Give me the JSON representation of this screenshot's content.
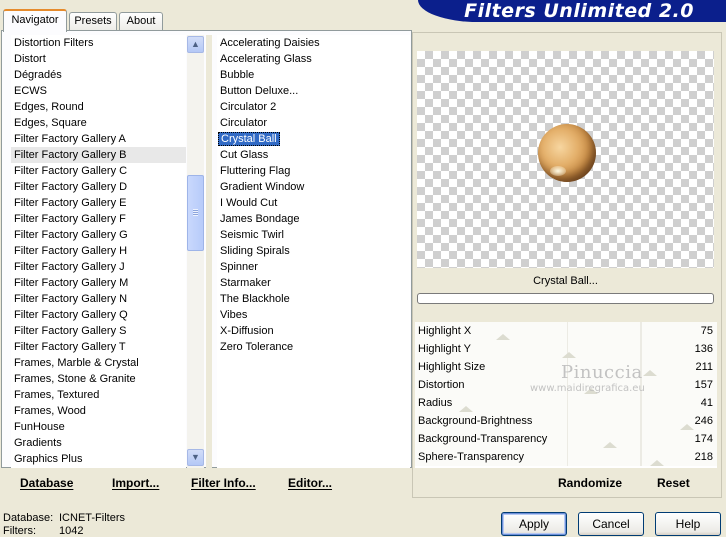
{
  "window": {
    "banner_title": "Filters Unlimited 2.0"
  },
  "tabs": [
    {
      "label": "Navigator",
      "active": true
    },
    {
      "label": "Presets",
      "active": false
    },
    {
      "label": "About",
      "active": false
    }
  ],
  "categories": {
    "items": [
      "Distortion Filters",
      "Distort",
      "Dégradés",
      "ECWS",
      "Edges, Round",
      "Edges, Square",
      "Filter Factory Gallery A",
      "Filter Factory Gallery B",
      "Filter Factory Gallery C",
      "Filter Factory Gallery D",
      "Filter Factory Gallery E",
      "Filter Factory Gallery F",
      "Filter Factory Gallery G",
      "Filter Factory Gallery H",
      "Filter Factory Gallery J",
      "Filter Factory Gallery M",
      "Filter Factory Gallery N",
      "Filter Factory Gallery Q",
      "Filter Factory Gallery S",
      "Filter Factory Gallery T",
      "Frames, Marble & Crystal",
      "Frames, Stone & Granite",
      "Frames, Textured",
      "Frames, Wood",
      "FunHouse",
      "Gradients",
      "Graphics Plus"
    ],
    "selected": "Filter Factory Gallery B",
    "scroll_position": 0.55
  },
  "filters": {
    "items": [
      "Accelerating Daisies",
      "Accelerating Glass",
      "Bubble",
      "Button Deluxe...",
      "Circulator 2",
      "Circulator",
      "Crystal Ball",
      "Cut Glass",
      "Fluttering Flag",
      "Gradient Window",
      "I Would Cut",
      "James Bondage",
      "Seismic Twirl",
      "Sliding Spirals",
      "Spinner",
      "Starmaker",
      "The Blackhole",
      "Vibes",
      "X-Diffusion",
      "Zero Tolerance"
    ],
    "selected": "Crystal Ball"
  },
  "left_buttons": {
    "database": "Database",
    "import": "Import...",
    "filter_info": "Filter Info...",
    "editor": "Editor..."
  },
  "preview": {
    "filter_name": "Crystal Ball...",
    "progress": 0
  },
  "params": [
    {
      "label": "Highlight X",
      "value": "75",
      "level": 75
    },
    {
      "label": "Highlight Y",
      "value": "136",
      "level": 136
    },
    {
      "label": "Highlight Size",
      "value": "211",
      "level": 211
    },
    {
      "label": "Distortion",
      "value": "157",
      "level": 157
    },
    {
      "label": "Radius",
      "value": "41",
      "level": 41
    },
    {
      "label": "Background-Brightness",
      "value": "246",
      "level": 246
    },
    {
      "label": "Background-Transparency",
      "value": "174",
      "level": 174
    },
    {
      "label": "Sphere-Transparency",
      "value": "218",
      "level": 218
    }
  ],
  "param_buttons": {
    "randomize": "Randomize",
    "reset": "Reset"
  },
  "watermark": {
    "name": "Pinuccia",
    "site": "www.maidiregrafica.eu"
  },
  "status": {
    "database_label": "Database:",
    "database_value": "ICNET-Filters",
    "filters_label": "Filters:",
    "filters_value": "1042"
  },
  "dialog_buttons": {
    "apply": "Apply",
    "cancel": "Cancel",
    "help": "Help"
  }
}
